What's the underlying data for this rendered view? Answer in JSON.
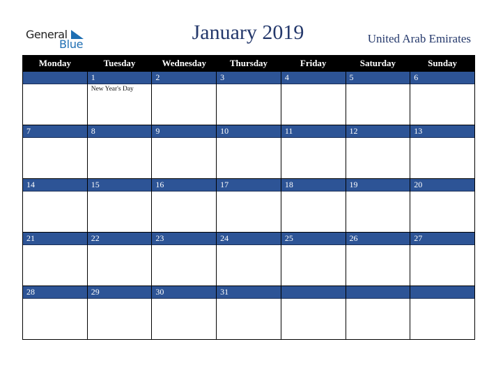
{
  "logo": {
    "word1": "General",
    "word2": "Blue"
  },
  "title": "January 2019",
  "country": "United Arab Emirates",
  "weekdays": [
    "Monday",
    "Tuesday",
    "Wednesday",
    "Thursday",
    "Friday",
    "Saturday",
    "Sunday"
  ],
  "weeks": [
    [
      {
        "day": "",
        "holiday": ""
      },
      {
        "day": "1",
        "holiday": "New Year's Day"
      },
      {
        "day": "2",
        "holiday": ""
      },
      {
        "day": "3",
        "holiday": ""
      },
      {
        "day": "4",
        "holiday": ""
      },
      {
        "day": "5",
        "holiday": ""
      },
      {
        "day": "6",
        "holiday": ""
      }
    ],
    [
      {
        "day": "7",
        "holiday": ""
      },
      {
        "day": "8",
        "holiday": ""
      },
      {
        "day": "9",
        "holiday": ""
      },
      {
        "day": "10",
        "holiday": ""
      },
      {
        "day": "11",
        "holiday": ""
      },
      {
        "day": "12",
        "holiday": ""
      },
      {
        "day": "13",
        "holiday": ""
      }
    ],
    [
      {
        "day": "14",
        "holiday": ""
      },
      {
        "day": "15",
        "holiday": ""
      },
      {
        "day": "16",
        "holiday": ""
      },
      {
        "day": "17",
        "holiday": ""
      },
      {
        "day": "18",
        "holiday": ""
      },
      {
        "day": "19",
        "holiday": ""
      },
      {
        "day": "20",
        "holiday": ""
      }
    ],
    [
      {
        "day": "21",
        "holiday": ""
      },
      {
        "day": "22",
        "holiday": ""
      },
      {
        "day": "23",
        "holiday": ""
      },
      {
        "day": "24",
        "holiday": ""
      },
      {
        "day": "25",
        "holiday": ""
      },
      {
        "day": "26",
        "holiday": ""
      },
      {
        "day": "27",
        "holiday": ""
      }
    ],
    [
      {
        "day": "28",
        "holiday": ""
      },
      {
        "day": "29",
        "holiday": ""
      },
      {
        "day": "30",
        "holiday": ""
      },
      {
        "day": "31",
        "holiday": ""
      },
      {
        "day": "",
        "holiday": ""
      },
      {
        "day": "",
        "holiday": ""
      },
      {
        "day": "",
        "holiday": ""
      }
    ]
  ]
}
